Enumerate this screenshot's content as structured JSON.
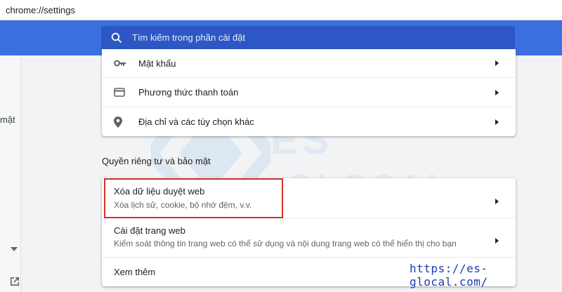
{
  "address_bar": {
    "url": "chrome://settings"
  },
  "search": {
    "placeholder": "Tìm kiếm trong phần cài đặt"
  },
  "left_panel": {
    "partial_label": "mật"
  },
  "autofill_items": [
    {
      "label": "Mật khẩu",
      "icon": "key-icon"
    },
    {
      "label": "Phương thức thanh toán",
      "icon": "credit-card-icon"
    },
    {
      "label": "Địa chỉ và các tùy chọn khác",
      "icon": "location-pin-icon"
    }
  ],
  "privacy_section": {
    "title": "Quyền riêng tư và bảo mật",
    "items": [
      {
        "title": "Xóa dữ liệu duyệt web",
        "subtitle": "Xóa lịch sử, cookie, bộ nhớ đệm, v.v."
      },
      {
        "title": "Cài đặt trang web",
        "subtitle": "Kiểm soát thông tin trang web có thể sử dụng và nội dung trang web có thể hiển thị cho bạn"
      },
      {
        "title": "Xem thêm"
      }
    ]
  },
  "watermark": {
    "line1": "ES",
    "line2": "GLOCAL",
    "url": "https://es-glocal.com/"
  },
  "colors": {
    "header_blue": "#3b6fe0",
    "search_bg": "#2c57c4",
    "highlight_red": "#d93025",
    "overlay_url": "#1a3cb0"
  }
}
